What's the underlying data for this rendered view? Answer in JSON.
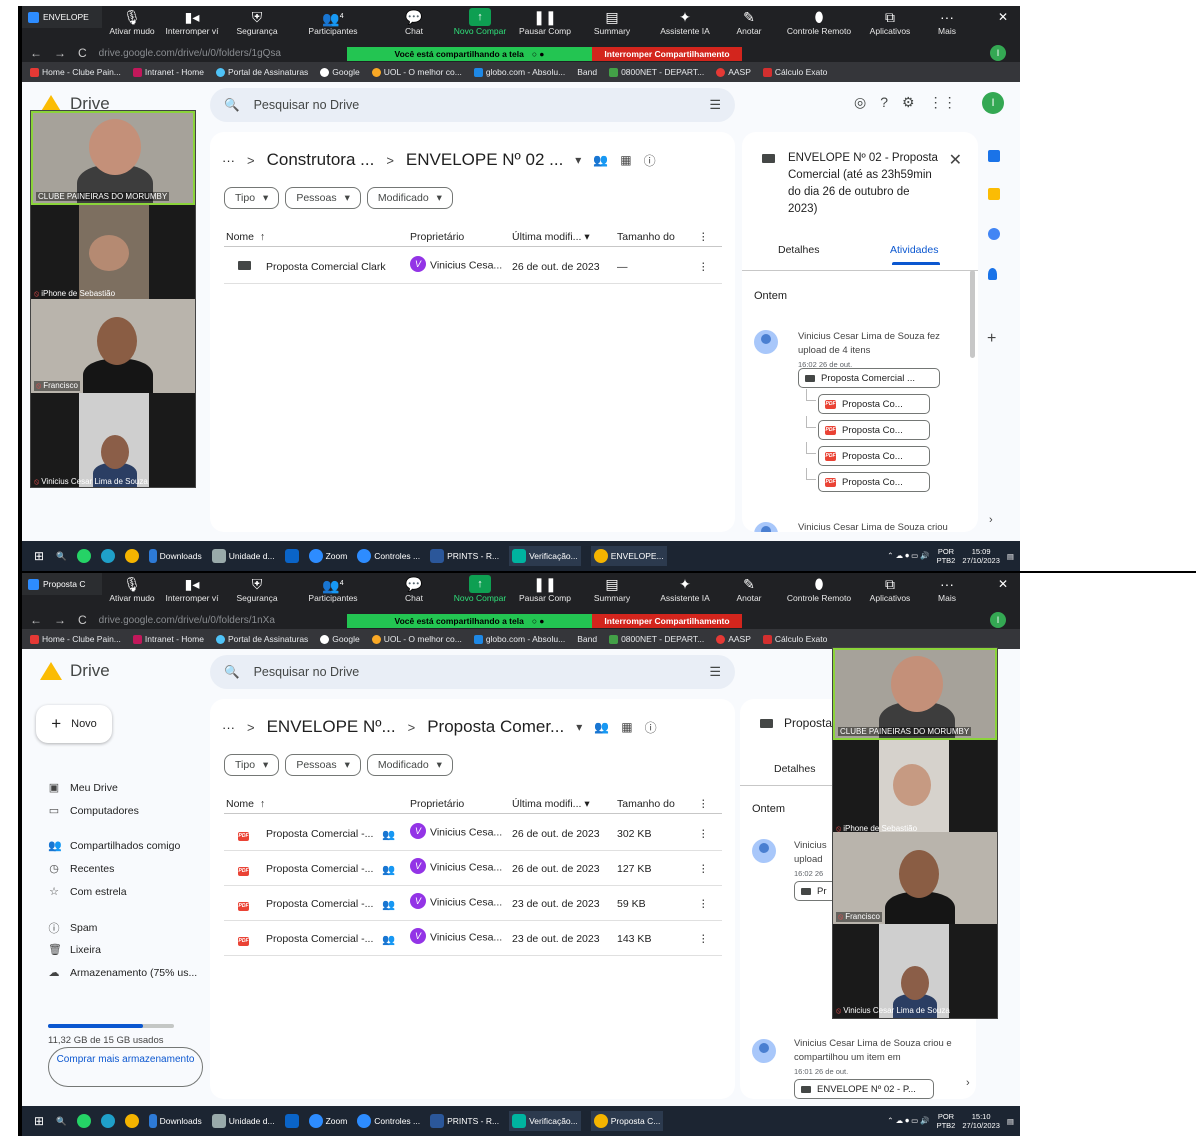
{
  "zoom": {
    "tab1": "ENVELOPE",
    "tab2": "Proposta C",
    "buttons": [
      {
        "label": "Ativar mudo",
        "icon": "mic-icon"
      },
      {
        "label": "Interromper ví",
        "icon": "video-icon"
      },
      {
        "label": "Segurança",
        "icon": "shield-icon"
      },
      {
        "label": "Participantes",
        "icon": "participants-icon",
        "count": "4"
      },
      {
        "label": "Chat",
        "icon": "chat-icon"
      },
      {
        "label": "Novo Compar",
        "icon": "share-icon"
      },
      {
        "label": "Pausar Comp",
        "icon": "pause-icon"
      },
      {
        "label": "Summary",
        "icon": "summary-icon"
      },
      {
        "label": "Assistente IA",
        "icon": "ai-icon"
      },
      {
        "label": "Anotar",
        "icon": "pen-icon"
      },
      {
        "label": "Controle Remoto",
        "icon": "mouse-icon"
      },
      {
        "label": "Aplicativos",
        "icon": "apps-icon"
      },
      {
        "label": "Mais",
        "icon": "more-icon"
      }
    ],
    "sharing": "Você está compartilhando a tela",
    "stop_share": "Interromper Compartilhamento",
    "participants": [
      "CLUBE PAINEIRAS DO MORUMBY",
      "iPhone de Sebastião",
      "Francisco",
      "Vinicius Cesar Lima de Souza"
    ]
  },
  "browser": {
    "url1": "drive.google.com/drive/u/0/folders/1gQsa",
    "url2": "drive.google.com/drive/u/0/folders/1nXa",
    "avatar": "I",
    "bookmarks": [
      "Home - Clube Pain...",
      "Intranet - Home",
      "Portal de Assinaturas",
      "Google",
      "UOL - O melhor co...",
      "globo.com - Absolu...",
      "Band",
      "0800NET - DEPART...",
      "AASP",
      "Cálculo Exato"
    ]
  },
  "drive": {
    "logo": "Drive",
    "search_placeholder": "Pesquisar no Drive",
    "user_initial": "I",
    "new_label": "Novo",
    "nav": [
      "Meu Drive",
      "Computadores",
      "Compartilhados comigo",
      "Recentes",
      "Com estrela",
      "Spam",
      "Lixeira",
      "Armazenamento (75% us..."
    ],
    "storage_used": "11,32 GB de 15 GB usados",
    "storage_fraction": 0.75,
    "buy": "Comprar mais armazenamento",
    "filters": [
      "Tipo",
      "Pessoas",
      "Modificado"
    ],
    "cols": [
      "Nome",
      "Proprietário",
      "Última modifi...",
      "Tamanho do"
    ]
  },
  "view1": {
    "crumbs": [
      "Construtora ...",
      "ENVELOPE Nº 02 ..."
    ],
    "rows": [
      {
        "name": "Proposta Comercial Clark",
        "owner": "Vinicius Cesa...",
        "modified": "26 de out. de 2023",
        "size": "—"
      }
    ],
    "panel_title": "ENVELOPE Nº 02 - Proposta Comercial (até as 23h59min do dia 26 de outubro de 2023)",
    "tab_details": "Detalhes",
    "tab_activity": "Atividades",
    "ontem": "Ontem",
    "activity": "Vinicius Cesar Lima de Souza fez upload de 4 itens",
    "activity_time": "16:02 26 de out.",
    "folder_item": "Proposta Comercial ...",
    "file_item": "Proposta Co...",
    "more_activity": "Vinicius Cesar Lima de Souza criou"
  },
  "view2": {
    "crumbs": [
      "ENVELOPE Nº...",
      "Proposta Comer..."
    ],
    "rows": [
      {
        "name": "Proposta Comercial -...",
        "owner": "Vinicius Cesa...",
        "modified": "26 de out. de 2023",
        "size": "302 KB"
      },
      {
        "name": "Proposta Comercial -...",
        "owner": "Vinicius Cesa...",
        "modified": "26 de out. de 2023",
        "size": "127 KB"
      },
      {
        "name": "Proposta Comercial -...",
        "owner": "Vinicius Cesa...",
        "modified": "23 de out. de 2023",
        "size": "59 KB"
      },
      {
        "name": "Proposta Comercial -...",
        "owner": "Vinicius Cesa...",
        "modified": "23 de out. de 2023",
        "size": "143 KB"
      }
    ],
    "panel_title": "Proposta",
    "tab_details": "Detalhes",
    "ontem": "Ontem",
    "act_a": "Vinicius",
    "act_b": "upload",
    "time_a": "16:02 26",
    "folder_stub": "Pr",
    "act2": "Vinicius Cesar Lima de Souza criou e compartilhou um item em",
    "act2_time": "16:01 26 de out.",
    "act2_item": "ENVELOPE Nº 02 - P..."
  },
  "taskbar": {
    "items1": [
      "Downloads",
      "Unidade d...",
      "Zoom",
      "Controles ...",
      "PRINTS - R...",
      "Verificação...",
      "ENVELOPE..."
    ],
    "items2": [
      "Downloads",
      "Unidade d...",
      "Zoom",
      "Controles ...",
      "PRINTS - R...",
      "Verificação...",
      "Proposta C..."
    ],
    "lang": "POR",
    "layout": "PTB2",
    "time1": "15:09",
    "time2": "15:10",
    "date": "27/10/2023"
  },
  "colors": {
    "drive_blue": "#0b57d0",
    "zoom_green": "#23c552",
    "zoom_red": "#d3251d",
    "taskbar": "#1c2532"
  }
}
